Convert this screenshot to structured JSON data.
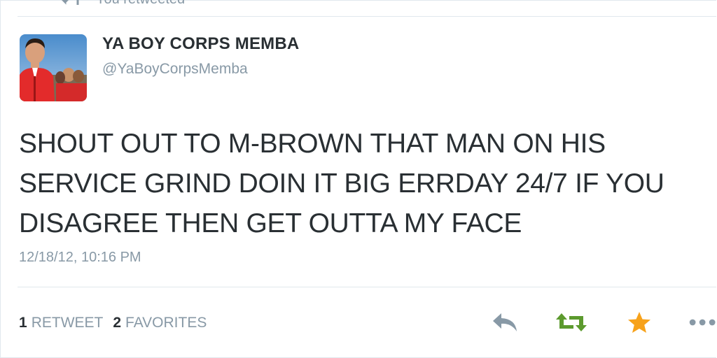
{
  "header": {
    "retweeted_label": "You retweeted"
  },
  "tweet": {
    "display_name": "YA BOY CORPS MEMBA",
    "handle": "@YaBoyCorpsMemba",
    "text": "SHOUT OUT TO M-BROWN THAT MAN ON HIS\nSERVICE GRIND DOIN IT BIG ERRDAY 24/7 IF YOU\nDISAGREE THEN GET OUTTA MY FACE",
    "timestamp": "12/18/12, 10:16 PM"
  },
  "stats": {
    "retweet_count": "1",
    "retweet_label": "RETWEET",
    "favorite_count": "2",
    "favorite_label": "FAVORITES"
  },
  "actions": {
    "reply_icon": "reply-icon",
    "retweet_icon": "retweet-icon",
    "favorite_icon": "star-icon",
    "more_icon": "more-icon"
  },
  "colors": {
    "retweet_active": "#5c9a2e",
    "favorite_active": "#f7a21b",
    "muted": "#8899a6",
    "text": "#292f33"
  }
}
